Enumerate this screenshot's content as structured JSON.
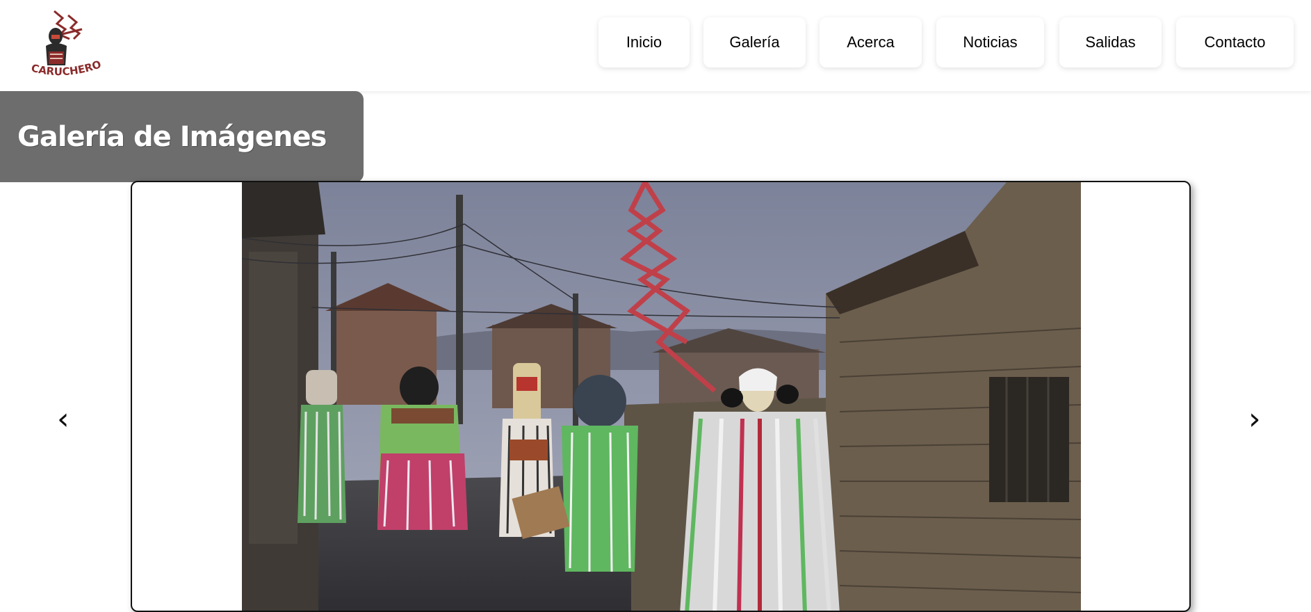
{
  "logo": {
    "text": "CARUCHEROS",
    "icon": "carucheros-logo"
  },
  "nav": {
    "items": [
      {
        "label": "Inicio"
      },
      {
        "label": "Galería"
      },
      {
        "label": "Acerca"
      },
      {
        "label": "Noticias"
      },
      {
        "label": "Salidas"
      },
      {
        "label": "Contacto"
      }
    ]
  },
  "page": {
    "title": "Galería de Imágenes"
  },
  "carousel": {
    "prev_label": "‹",
    "next_label": "›",
    "image": {
      "subject": "carnival-masked-figures-photo"
    }
  },
  "colors": {
    "brand": "#8b2a2a",
    "title_bg": "#6d6d6d",
    "text": "#000000"
  }
}
